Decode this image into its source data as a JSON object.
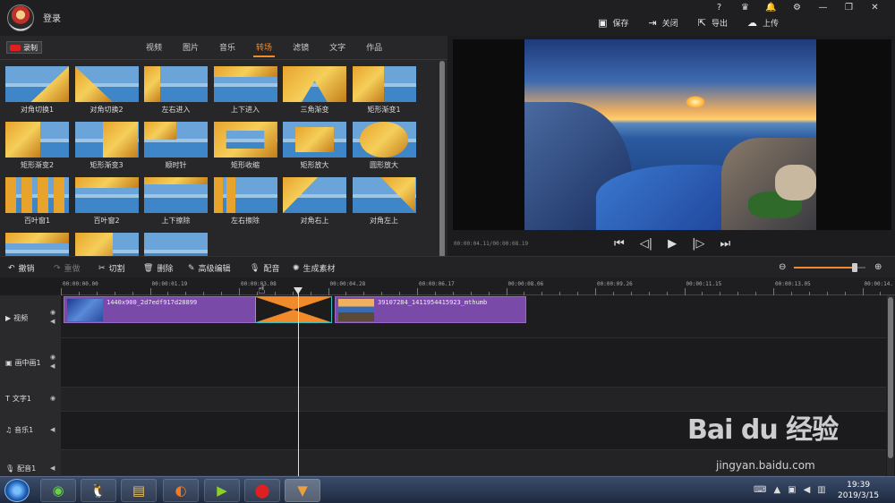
{
  "titlebar": {
    "login": "登录",
    "win_icons": [
      "?",
      "VIP",
      "bell-icon",
      "gear-icon",
      "minimize-icon",
      "maximize-icon",
      "close-icon"
    ],
    "buttons": [
      {
        "label": "保存",
        "icon": "save-icon"
      },
      {
        "label": "关闭",
        "icon": "exit-icon"
      },
      {
        "label": "导出",
        "icon": "export-icon"
      },
      {
        "label": "上传",
        "icon": "upload-icon"
      }
    ]
  },
  "left_panel": {
    "record_label": "录制",
    "tabs": [
      {
        "label": "视频",
        "active": false
      },
      {
        "label": "图片",
        "active": false
      },
      {
        "label": "音乐",
        "active": false
      },
      {
        "label": "转场",
        "active": true
      },
      {
        "label": "滤镜",
        "active": false
      },
      {
        "label": "文字",
        "active": false
      },
      {
        "label": "作品",
        "active": false
      }
    ],
    "transitions": [
      {
        "label": "对角切换1"
      },
      {
        "label": "对角切换2"
      },
      {
        "label": "左右进入"
      },
      {
        "label": "上下进入"
      },
      {
        "label": "三角渐变"
      },
      {
        "label": "矩形渐变1"
      },
      {
        "label": "矩形渐变2"
      },
      {
        "label": "矩形渐变3"
      },
      {
        "label": "顺时针"
      },
      {
        "label": "矩形收缩"
      },
      {
        "label": "矩形放大"
      },
      {
        "label": "圆形放大"
      },
      {
        "label": "百叶窗1"
      },
      {
        "label": "百叶窗2"
      },
      {
        "label": "上下擦除"
      },
      {
        "label": "左右擦除"
      },
      {
        "label": "对角右上"
      },
      {
        "label": "对角左上"
      },
      {
        "label": ""
      },
      {
        "label": ""
      },
      {
        "label": ""
      }
    ]
  },
  "preview": {
    "timecode": "00:00:04.11/00:00:08.19",
    "controls": [
      "skip-start-icon",
      "step-back-icon",
      "play-icon",
      "step-forward-icon",
      "skip-end-icon"
    ]
  },
  "edit_toolbar": {
    "undo": "撤销",
    "redo": "重做",
    "cut": "切割",
    "delete": "删除",
    "advanced": "高级编辑",
    "dub": "配音",
    "generate": "生成素材",
    "zoom_level": 0.85
  },
  "ruler": {
    "ticks": [
      "00:00:00.00",
      "00:00:01.19",
      "00:00:03.08",
      "00:00:04.28",
      "00:00:06.17",
      "00:00:08.06",
      "00:00:09.26",
      "00:00:11.15",
      "00:00:13.05",
      "00:00:14."
    ]
  },
  "tracks": [
    {
      "label": "视频",
      "icon": "play-square-icon"
    },
    {
      "label": "画中画1",
      "icon": "pip-icon"
    },
    {
      "label": "文字1",
      "icon": "text-icon"
    },
    {
      "label": "音乐1",
      "icon": "music-icon"
    },
    {
      "label": "配音1",
      "icon": "mic-icon"
    }
  ],
  "clips": [
    {
      "name": "1440x900_2d7edf917d28899"
    },
    {
      "name": "39107284_1411954415923_mthumb"
    }
  ],
  "taskbar": {
    "time": "19:39",
    "date": "2019/3/15"
  },
  "watermark": {
    "brand": "Bai du 经验",
    "url": "jingyan.baidu.com"
  },
  "colors": {
    "accent": "#f08a2a",
    "clip": "#7a4aa8",
    "transition_border": "#3ac0c0"
  }
}
